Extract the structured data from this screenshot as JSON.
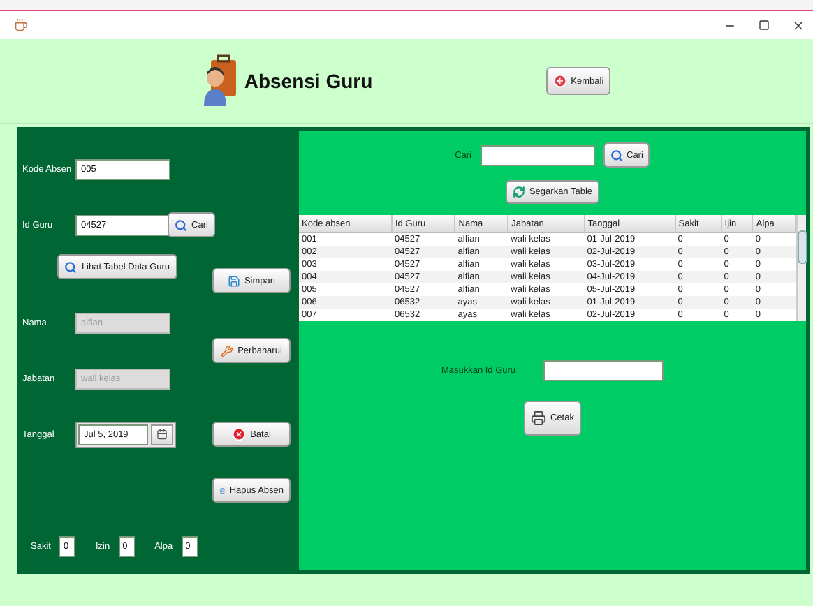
{
  "header": {
    "title": "Absensi Guru",
    "back_button": "Kembali"
  },
  "form": {
    "kode_absen": {
      "label": "Kode Absen",
      "value": "005",
      "disabled": false
    },
    "id_guru": {
      "label": "Id Guru",
      "value": "04527",
      "disabled": false
    },
    "search_button": "Cari",
    "lookup_button": "Lihat Tabel Data Guru",
    "nama": {
      "label": "Nama",
      "value": "alfian",
      "disabled": true
    },
    "jabatan": {
      "label": "Jabatan",
      "value": "wali kelas",
      "disabled": true
    },
    "tanggal": {
      "label": "Tanggal",
      "value": "Jul 5, 2019"
    },
    "save_button": "Simpan",
    "update_button": "Perbaharui",
    "cancel_button": "Batal",
    "delete_button": "Hapus Absen",
    "counts": [
      {
        "label": "Sakit",
        "value": "0"
      },
      {
        "label": "Izin",
        "value": "0"
      },
      {
        "label": "Alpa",
        "value": "0"
      }
    ]
  },
  "table_panel": {
    "search": {
      "label": "Cari",
      "button": "Cari"
    },
    "refresh_button": "Segarkan Table",
    "table": {
      "columns": [
        "Kode absen",
        "Id Guru",
        "Nama",
        "Jabatan",
        "Tanggal",
        "Sakit",
        "Ijin",
        "Alpa"
      ],
      "rows": [
        [
          "001",
          "04527",
          "alfian",
          "wali kelas",
          "01-Jul-2019",
          "0",
          "0",
          "0"
        ],
        [
          "002",
          "04527",
          "alfian",
          "wali kelas",
          "02-Jul-2019",
          "0",
          "0",
          "0"
        ],
        [
          "003",
          "04527",
          "alfian",
          "wali kelas",
          "03-Jul-2019",
          "0",
          "0",
          "0"
        ],
        [
          "004",
          "04527",
          "alfian",
          "wali kelas",
          "04-Jul-2019",
          "0",
          "0",
          "0"
        ],
        [
          "005",
          "04527",
          "alfian",
          "wali kelas",
          "05-Jul-2019",
          "0",
          "0",
          "0"
        ],
        [
          "006",
          "06532",
          "ayas",
          "wali kelas",
          "01-Jul-2019",
          "0",
          "0",
          "0"
        ],
        [
          "007",
          "06532",
          "ayas",
          "wali kelas",
          "02-Jul-2019",
          "0",
          "0",
          "0"
        ]
      ]
    },
    "print": {
      "label": "Masukkan Id Guru",
      "button": "Cetak"
    }
  }
}
